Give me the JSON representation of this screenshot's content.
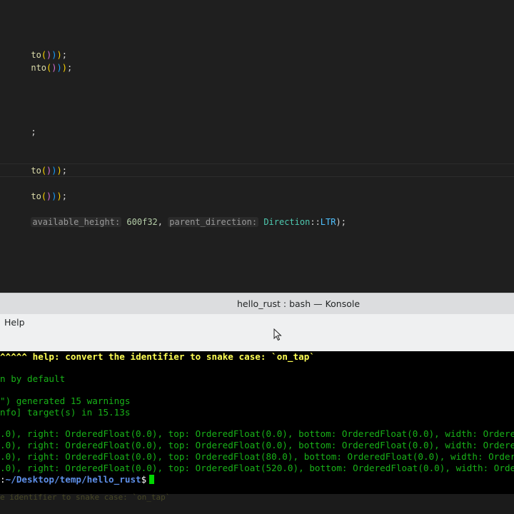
{
  "editor": {
    "lines": [
      {
        "text_start": "to",
        "text_end": ";"
      },
      {
        "text_start": "nto",
        "text_end": ";"
      },
      {
        "text": ";"
      },
      {
        "text_start": "to",
        "text_end": ";"
      },
      {
        "text_start": "to",
        "text_end": ";"
      },
      {
        "hint1": "available_height:",
        "value1": "600f32",
        "sep": ",",
        "hint2": "parent_direction:",
        "type": "Direction",
        "path_sep": "::",
        "variant": "LTR",
        "end": ");"
      }
    ]
  },
  "konsole": {
    "window_title": "hello_rust : bash — Konsole",
    "menu": {
      "help_label": "Help"
    },
    "icons": {
      "cursor": "mouse-pointer-icon"
    },
    "terminal": {
      "line1_carets": "^^^^^ ",
      "line1_help": "help: convert the identifier to snake case: `on_tap`",
      "line2": "n by default",
      "line3": "\") generated 15 warnings",
      "line4": "nfo] target(s) in 15.13s",
      "line5": ".0), right: OrderedFloat(0.0), top: OrderedFloat(0.0), bottom: OrderedFloat(0.0), width: Ordered",
      "line6": ".0), right: OrderedFloat(0.0), top: OrderedFloat(0.0), bottom: OrderedFloat(0.0), width: Ordered",
      "line7": ".0), right: OrderedFloat(0.0), top: OrderedFloat(80.0), bottom: OrderedFloat(0.0), width: Ordere",
      "line8": ".0), right: OrderedFloat(0.0), top: OrderedFloat(520.0), bottom: OrderedFloat(0.0), width: Ordere",
      "prompt_prefix": ":",
      "prompt_path": "~/Desktop/temp/hello_rust",
      "prompt_symbol": "$"
    },
    "ghost_text": "e identifier to snake case: `on_tap`"
  },
  "colors": {
    "terminal_bg": "#000000",
    "terminal_text": "#18b218",
    "help_text": "#ffff54",
    "path_text": "#5e8fe8"
  }
}
